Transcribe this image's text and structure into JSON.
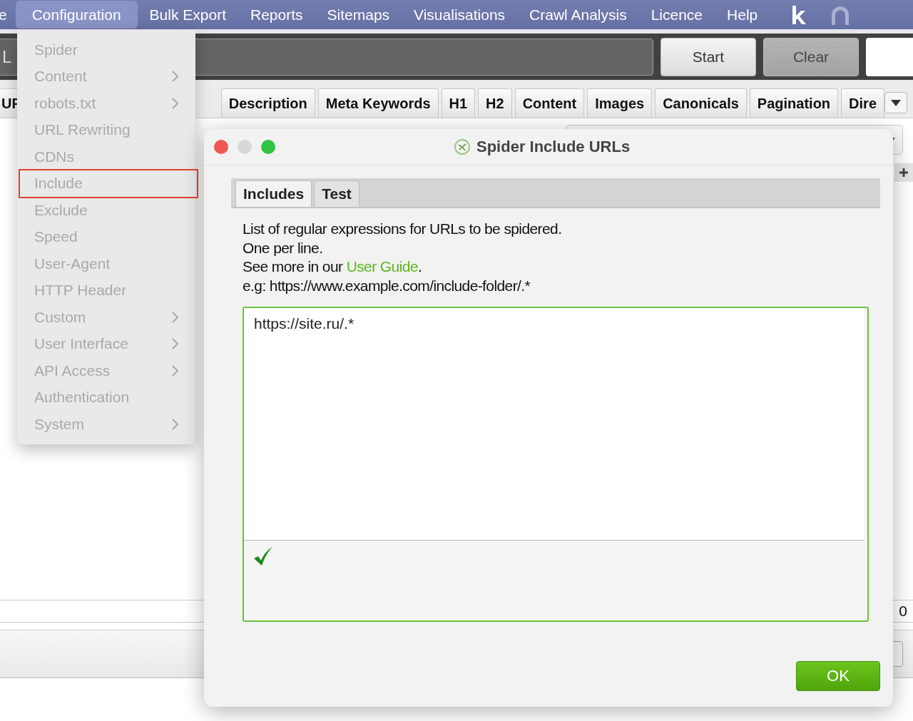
{
  "menubar": {
    "items": [
      {
        "label": "e",
        "selected": false
      },
      {
        "label": "Configuration",
        "selected": true
      },
      {
        "label": "Bulk Export",
        "selected": false
      },
      {
        "label": "Reports",
        "selected": false
      },
      {
        "label": "Sitemaps",
        "selected": false
      },
      {
        "label": "Visualisations",
        "selected": false
      },
      {
        "label": "Crawl Analysis",
        "selected": false
      },
      {
        "label": "Licence",
        "selected": false
      },
      {
        "label": "Help",
        "selected": false
      }
    ]
  },
  "toolbar": {
    "url_field": {
      "value": "L"
    },
    "buttons": [
      {
        "label": "Start",
        "disabled": false
      },
      {
        "label": "Clear",
        "disabled": true
      }
    ]
  },
  "tabs": [
    {
      "label": "UF",
      "selected": false
    },
    {
      "label": "Description",
      "selected": false
    },
    {
      "label": "Meta Keywords",
      "selected": false
    },
    {
      "label": "H1",
      "selected": false
    },
    {
      "label": "H2",
      "selected": false
    },
    {
      "label": "Content",
      "selected": false
    },
    {
      "label": "Images",
      "selected": false
    },
    {
      "label": "Canonicals",
      "selected": false
    },
    {
      "label": "Pagination",
      "selected": false
    },
    {
      "label": "Dire",
      "selected": false
    }
  ],
  "side_panel": {
    "count": "0"
  },
  "menu": {
    "items": [
      {
        "label": "Spider",
        "submenu": false,
        "highlighted": false
      },
      {
        "label": "Content",
        "submenu": true,
        "highlighted": false
      },
      {
        "label": "robots.txt",
        "submenu": true,
        "highlighted": false
      },
      {
        "label": "URL Rewriting",
        "submenu": false,
        "highlighted": false
      },
      {
        "label": "CDNs",
        "submenu": false,
        "highlighted": false
      },
      {
        "label": "Include",
        "submenu": false,
        "highlighted": true
      },
      {
        "label": "Exclude",
        "submenu": false,
        "highlighted": false
      },
      {
        "label": "Speed",
        "submenu": false,
        "highlighted": false
      },
      {
        "label": "User-Agent",
        "submenu": false,
        "highlighted": false
      },
      {
        "label": "HTTP Header",
        "submenu": false,
        "highlighted": false
      },
      {
        "label": "Custom",
        "submenu": true,
        "highlighted": false
      },
      {
        "label": "User Interface",
        "submenu": true,
        "highlighted": false
      },
      {
        "label": "API Access",
        "submenu": true,
        "highlighted": false
      },
      {
        "label": "Authentication",
        "submenu": false,
        "highlighted": false
      },
      {
        "label": "System",
        "submenu": true,
        "highlighted": false
      }
    ]
  },
  "dialog": {
    "title": "Spider Include URLs",
    "tabs": [
      {
        "label": "Includes",
        "selected": true
      },
      {
        "label": "Test",
        "selected": false
      }
    ],
    "lines": [
      "List of regular expressions for URLs to be spidered.",
      "One per line."
    ],
    "guide_line": {
      "before": "See more in our ",
      "link": "User Guide",
      "after": "."
    },
    "example": "e.g: https://www.example.com/include-folder/.*",
    "editor": {
      "value": "https://site.ru/.*",
      "valid": true
    },
    "ok_button": "OK"
  }
}
